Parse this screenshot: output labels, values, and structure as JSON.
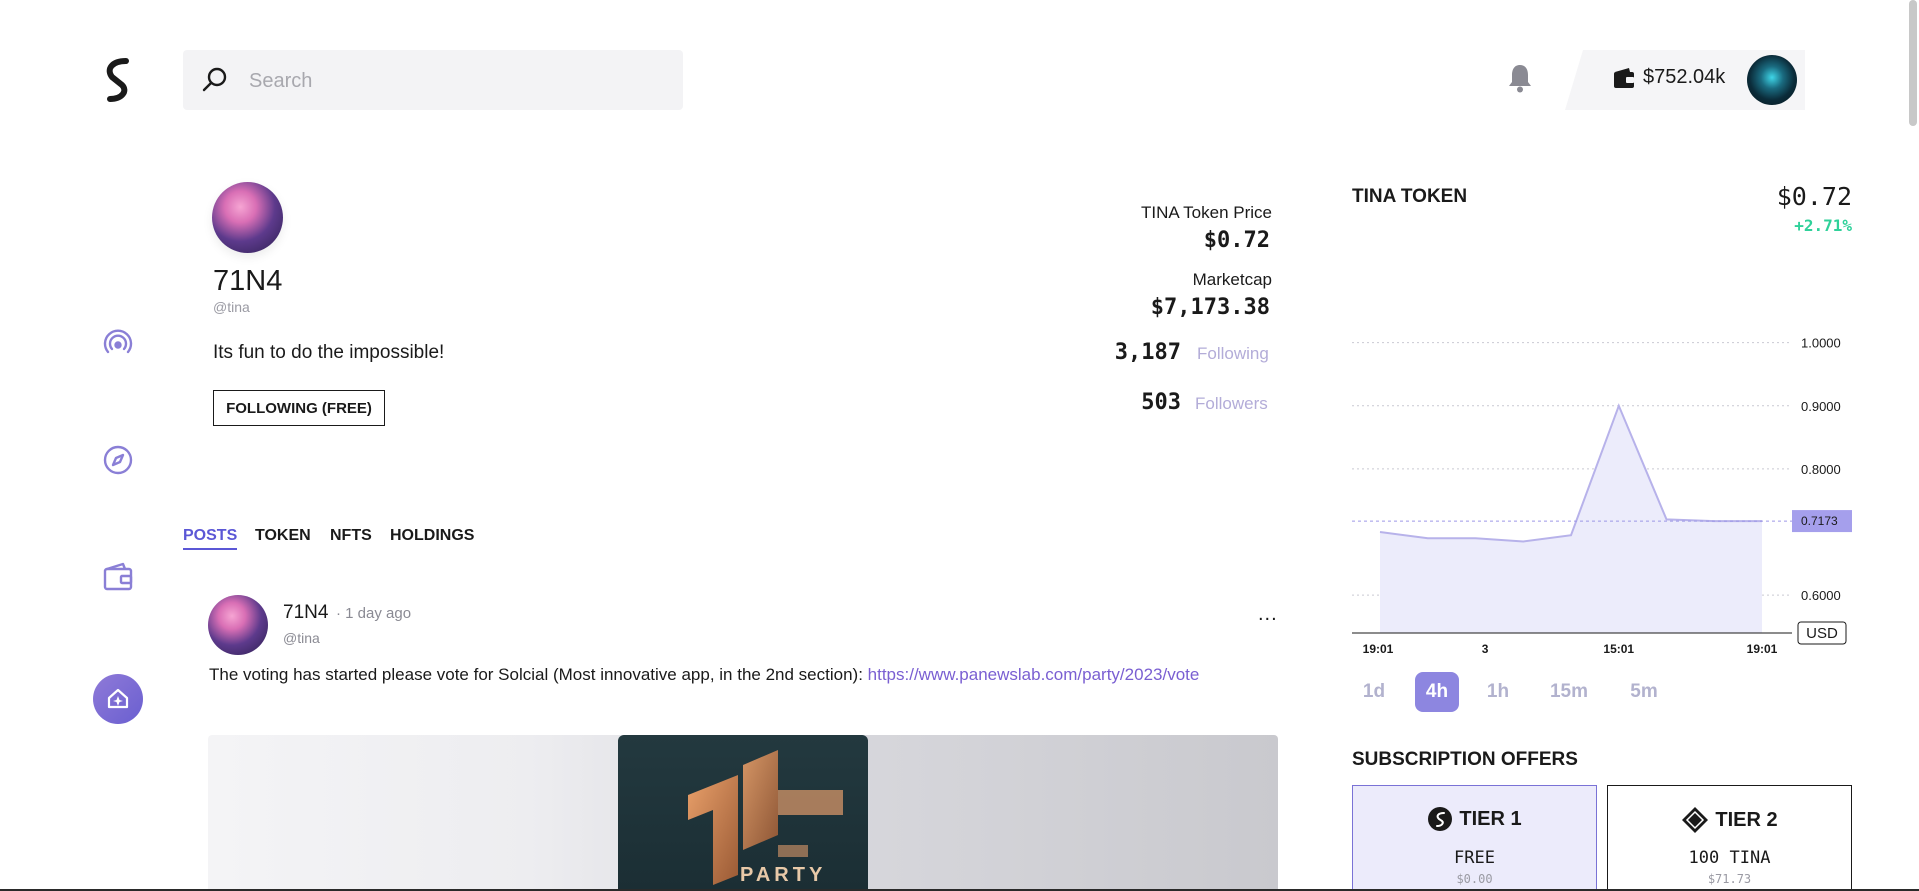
{
  "search": {
    "placeholder": "Search"
  },
  "header": {
    "balance": "$752.04k"
  },
  "profile": {
    "name": "71N4",
    "handle": "@tina",
    "bio": "Its fun to do the impossible!",
    "follow_label": "FOLLOWING (FREE)",
    "token_price_label": "TINA Token Price",
    "token_price": "$0.72",
    "marketcap_label": "Marketcap",
    "marketcap": "$7,173.38",
    "following_count": "3,187",
    "following_label": "Following",
    "followers_count": "503",
    "followers_label": "Followers"
  },
  "tabs": [
    {
      "label": "POSTS",
      "active": true
    },
    {
      "label": "TOKEN",
      "active": false
    },
    {
      "label": "NFTS",
      "active": false
    },
    {
      "label": "HOLDINGS",
      "active": false
    }
  ],
  "post": {
    "author": "71N4",
    "time": "· 1 day ago",
    "handle": "@tina",
    "more": "...",
    "text": "The voting has started please vote for Solcial (Most innovative app, in the 2nd section): ",
    "link": "https://www.panewslab.com/party/2023/vote",
    "image_caption": "PARTY"
  },
  "token": {
    "title": "TINA TOKEN",
    "price": "$0.72",
    "change": "+2.71%"
  },
  "chart_data": {
    "type": "area",
    "x": [
      0,
      1,
      2,
      3,
      4,
      5,
      6,
      7,
      8
    ],
    "values": [
      0.7,
      0.69,
      0.69,
      0.685,
      0.695,
      0.9,
      0.72,
      0.7173,
      0.7173
    ],
    "x_tick_labels": [
      "19:01",
      "3",
      "15:01",
      "19:01"
    ],
    "y_ticks": [
      "1.0000",
      "0.9000",
      "0.8000",
      "0.6000"
    ],
    "ylim": [
      0.54,
      1.02
    ],
    "current_value": "0.7173",
    "currency": "USD",
    "grid": true
  },
  "timeframes": [
    {
      "label": "1d",
      "active": false
    },
    {
      "label": "4h",
      "active": true
    },
    {
      "label": "1h",
      "active": false
    },
    {
      "label": "15m",
      "active": false
    },
    {
      "label": "5m",
      "active": false
    }
  ],
  "subscriptions": {
    "title": "SUBSCRIPTION OFFERS",
    "tiers": [
      {
        "name": "TIER 1",
        "price": "FREE",
        "sub": "$0.00"
      },
      {
        "name": "TIER 2",
        "price": "100 TINA",
        "sub": "$71.73"
      }
    ]
  }
}
